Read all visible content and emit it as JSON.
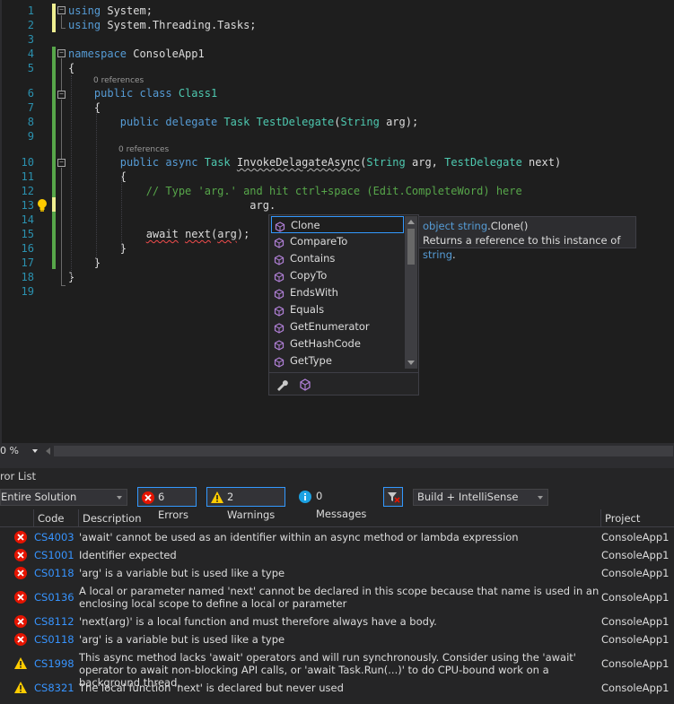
{
  "editor": {
    "lines": [
      {
        "n": "1",
        "html": "<span class=\"kw\">using</span> System;"
      },
      {
        "n": "2",
        "html": "<span class=\"kw\">using</span> System.Threading.Tasks;"
      },
      {
        "n": "3",
        "html": ""
      },
      {
        "n": "4",
        "html": "<span class=\"kw\">namespace</span> ConsoleApp1"
      },
      {
        "n": "5",
        "html": "{"
      },
      {
        "n": "6",
        "html": "    <span class=\"kw\">public</span> <span class=\"kw\">class</span> <span class=\"ty\">Class1</span>"
      },
      {
        "n": "7",
        "html": "    {"
      },
      {
        "n": "8",
        "html": "        <span class=\"kw\">public</span> <span class=\"kw\">delegate</span> <span class=\"ty\">Task</span> <span class=\"ty\">TestDelegate</span>(<span class=\"ty\">String</span> arg);"
      },
      {
        "n": "9",
        "html": ""
      },
      {
        "n": "10",
        "html": "        <span class=\"kw\">public</span> <span class=\"kw\">async</span> <span class=\"ty\">Task</span> <span class=\"squig-g\">InvokeDelagateAsync</span>(<span class=\"ty\">String</span> arg, <span class=\"ty\">TestDelegate</span> next)"
      },
      {
        "n": "11",
        "html": "        {"
      },
      {
        "n": "12",
        "html": "            <span class=\"cm\">// Type 'arg.' and hit ctrl+space (Edit.CompleteWord) here</span>"
      },
      {
        "n": "13",
        "html": "                            arg."
      },
      {
        "n": "14",
        "html": ""
      },
      {
        "n": "15",
        "html": "            <span class=\"squig\">await</span> <span class=\"squig\">next</span>(<span class=\"squig\">arg</span>);"
      },
      {
        "n": "16",
        "html": "        }"
      },
      {
        "n": "17",
        "html": "    }"
      },
      {
        "n": "18",
        "html": "}"
      },
      {
        "n": "19",
        "html": ""
      }
    ],
    "code_lens": [
      "0 references",
      "0 references"
    ]
  },
  "completion": {
    "items": [
      "Clone",
      "CompareTo",
      "Contains",
      "CopyTo",
      "EndsWith",
      "Equals",
      "GetEnumerator",
      "GetHashCode",
      "GetType"
    ],
    "selected": "Clone",
    "tooltip_sig_kw1": "object",
    "tooltip_sig_kw2": "string",
    "tooltip_sig_rest": ".Clone()",
    "tooltip_desc": "Returns a reference to this instance of ",
    "tooltip_desc_link": "string",
    "tooltip_desc_end": ".",
    "footer_icons": [
      "wrench-icon",
      "method-filter-icon"
    ]
  },
  "zoom": {
    "level": "0 %"
  },
  "error_list": {
    "title": "ror List",
    "scope": "Entire Solution",
    "errors_btn": "6 Errors",
    "warnings_btn": "2 Warnings",
    "messages_btn": "0 Messages",
    "build_filter": "Build + IntelliSense",
    "headers": {
      "code": "Code",
      "description": "Description",
      "project": "Project"
    },
    "rows": [
      {
        "type": "error",
        "code": "CS4003",
        "desc": "'await' cannot be used as an identifier within an async method or lambda expression",
        "project": "ConsoleApp1"
      },
      {
        "type": "error",
        "code": "CS1001",
        "desc": "Identifier expected",
        "project": "ConsoleApp1"
      },
      {
        "type": "error",
        "code": "CS0118",
        "desc": "'arg' is a variable but is used like a type",
        "project": "ConsoleApp1"
      },
      {
        "type": "error",
        "code": "CS0136",
        "desc": "A local or parameter named 'next' cannot be declared in this scope because that name is used in an enclosing local scope to define a local or parameter",
        "project": "ConsoleApp1"
      },
      {
        "type": "error",
        "code": "CS8112",
        "desc": "'next(arg)' is a local function and must therefore always have a body.",
        "project": "ConsoleApp1"
      },
      {
        "type": "error",
        "code": "CS0118",
        "desc": "'arg' is a variable but is used like a type",
        "project": "ConsoleApp1"
      },
      {
        "type": "warning",
        "code": "CS1998",
        "desc": "This async method lacks 'await' operators and will run synchronously. Consider using the 'await' operator to await non-blocking API calls, or 'await Task.Run(...)' to do CPU-bound work on a background thread.",
        "project": "ConsoleApp1"
      },
      {
        "type": "warning",
        "code": "CS8321",
        "desc": "The local function 'next' is declared but never used",
        "project": "ConsoleApp1"
      }
    ]
  },
  "colors": {
    "error": "#e51400",
    "warning": "#ffcc00",
    "link": "#3794ff",
    "selection": "#3399ff"
  }
}
